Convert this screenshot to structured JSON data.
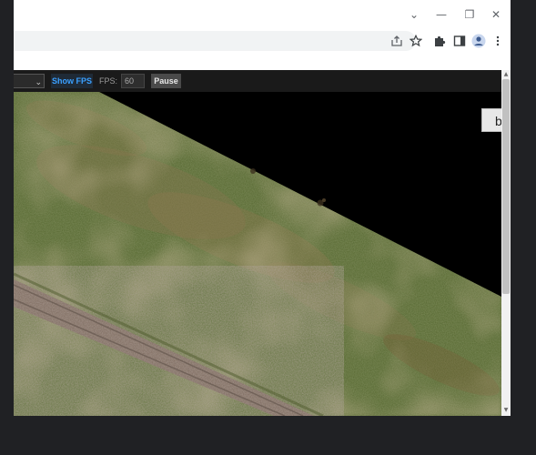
{
  "window": {
    "controls": {
      "dropdown": "⌄",
      "minimize": "—",
      "maximize": "❐",
      "close": "✕"
    }
  },
  "toolbar": {
    "icons": [
      "share-icon",
      "star-icon",
      "puzzle-extensions-icon",
      "side-panel-icon",
      "profile-icon",
      "kebab-menu-icon"
    ]
  },
  "game": {
    "select_arrow": "⌄",
    "show_fps_label": "Show FPS",
    "fps_label": "FPS:",
    "fps_value": "60",
    "pause_label": "Pause",
    "side_button_label": "b"
  },
  "colors": {
    "accent_blue": "#3aa0ff",
    "terrain_green": "#55672f",
    "terrain_dry": "#8e7850",
    "road": "#7d6a5e",
    "background": "#000000"
  }
}
